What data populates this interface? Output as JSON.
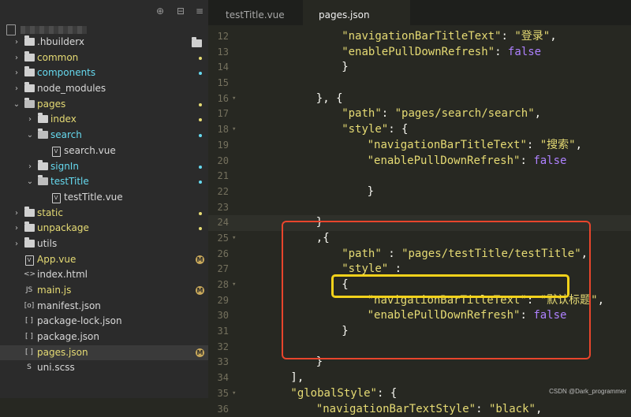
{
  "sidebar": {
    "toolbar_icons": [
      "target-icon",
      "collapse-icon",
      "menu-icon"
    ],
    "tree": [
      {
        "label": ".hbuilderx",
        "type": "folder",
        "depth": 0,
        "state": "closed",
        "color": "white",
        "badge": "folder"
      },
      {
        "label": "common",
        "type": "folder",
        "depth": 0,
        "state": "closed",
        "color": "yellow",
        "badge": "dot-yellow"
      },
      {
        "label": "components",
        "type": "folder",
        "depth": 0,
        "state": "closed",
        "color": "blue",
        "badge": "dot-blue"
      },
      {
        "label": "node_modules",
        "type": "folder",
        "depth": 0,
        "state": "closed",
        "color": "white",
        "badge": ""
      },
      {
        "label": "pages",
        "type": "folder",
        "depth": 0,
        "state": "open",
        "color": "yellow",
        "badge": "dot-yellow"
      },
      {
        "label": "index",
        "type": "folder",
        "depth": 1,
        "state": "closed",
        "color": "yellow",
        "badge": "dot-yellow"
      },
      {
        "label": "search",
        "type": "folder",
        "depth": 1,
        "state": "open",
        "color": "blue",
        "badge": "dot-blue"
      },
      {
        "label": "search.vue",
        "type": "file",
        "depth": 2,
        "icon": "V",
        "color": "white",
        "badge": ""
      },
      {
        "label": "signIn",
        "type": "folder",
        "depth": 1,
        "state": "closed",
        "color": "blue",
        "badge": "dot-blue"
      },
      {
        "label": "testTitle",
        "type": "folder",
        "depth": 1,
        "state": "open",
        "color": "blue",
        "badge": "dot-blue"
      },
      {
        "label": "testTitle.vue",
        "type": "file",
        "depth": 2,
        "icon": "V",
        "color": "white",
        "badge": ""
      },
      {
        "label": "static",
        "type": "folder",
        "depth": 0,
        "state": "closed",
        "color": "yellow",
        "badge": "dot-yellow"
      },
      {
        "label": "unpackage",
        "type": "folder",
        "depth": 0,
        "state": "closed",
        "color": "yellow",
        "badge": "dot-yellow"
      },
      {
        "label": "utils",
        "type": "folder",
        "depth": 0,
        "state": "closed",
        "color": "white",
        "badge": ""
      },
      {
        "label": "App.vue",
        "type": "file",
        "depth": 0,
        "icon": "V",
        "color": "yellow",
        "badge": "M"
      },
      {
        "label": "index.html",
        "type": "file",
        "depth": 0,
        "icon": "<>",
        "color": "white",
        "badge": ""
      },
      {
        "label": "main.js",
        "type": "file",
        "depth": 0,
        "icon": "JS",
        "color": "yellow",
        "badge": "M"
      },
      {
        "label": "manifest.json",
        "type": "file",
        "depth": 0,
        "icon": "[o]",
        "color": "white",
        "badge": ""
      },
      {
        "label": "package-lock.json",
        "type": "file",
        "depth": 0,
        "icon": "[ ]",
        "color": "white",
        "badge": ""
      },
      {
        "label": "package.json",
        "type": "file",
        "depth": 0,
        "icon": "[ ]",
        "color": "white",
        "badge": ""
      },
      {
        "label": "pages.json",
        "type": "file",
        "depth": 0,
        "icon": "[ ]",
        "color": "yellow",
        "badge": "M",
        "selected": true
      },
      {
        "label": "uni.scss",
        "type": "file",
        "depth": 0,
        "icon": "S",
        "color": "white",
        "badge": ""
      }
    ]
  },
  "tabs": [
    {
      "label": "testTitle.vue",
      "active": false
    },
    {
      "label": "pages.json",
      "active": true
    }
  ],
  "code_lines": [
    {
      "n": "12",
      "fold": "",
      "indent": 12,
      "tokens": [
        [
          "s",
          "\"navigationBarTitleText\""
        ],
        [
          "p",
          ": "
        ],
        [
          "s",
          "\"登录\""
        ],
        [
          "p",
          ","
        ]
      ]
    },
    {
      "n": "13",
      "fold": "",
      "indent": 12,
      "tokens": [
        [
          "s",
          "\"enablePullDownRefresh\""
        ],
        [
          "p",
          ": "
        ],
        [
          "b",
          "false"
        ]
      ]
    },
    {
      "n": "14",
      "fold": "",
      "indent": 12,
      "tokens": [
        [
          "p",
          "}"
        ]
      ]
    },
    {
      "n": "15",
      "fold": "",
      "indent": 0,
      "tokens": []
    },
    {
      "n": "16",
      "fold": "▾",
      "indent": 8,
      "tokens": [
        [
          "p",
          "}, {"
        ]
      ]
    },
    {
      "n": "17",
      "fold": "",
      "indent": 12,
      "tokens": [
        [
          "s",
          "\"path\""
        ],
        [
          "p",
          ": "
        ],
        [
          "s",
          "\"pages/search/search\""
        ],
        [
          "p",
          ","
        ]
      ]
    },
    {
      "n": "18",
      "fold": "▾",
      "indent": 12,
      "tokens": [
        [
          "s",
          "\"style\""
        ],
        [
          "p",
          ": {"
        ]
      ]
    },
    {
      "n": "19",
      "fold": "",
      "indent": 16,
      "tokens": [
        [
          "s",
          "\"navigationBarTitleText\""
        ],
        [
          "p",
          ": "
        ],
        [
          "s",
          "\"搜索\""
        ],
        [
          "p",
          ","
        ]
      ]
    },
    {
      "n": "20",
      "fold": "",
      "indent": 16,
      "tokens": [
        [
          "s",
          "\"enablePullDownRefresh\""
        ],
        [
          "p",
          ": "
        ],
        [
          "b",
          "false"
        ]
      ]
    },
    {
      "n": "21",
      "fold": "",
      "indent": 0,
      "tokens": []
    },
    {
      "n": "22",
      "fold": "",
      "indent": 16,
      "tokens": [
        [
          "p",
          "}"
        ]
      ]
    },
    {
      "n": "23",
      "fold": "",
      "indent": 0,
      "tokens": []
    },
    {
      "n": "24",
      "fold": "",
      "indent": 8,
      "tokens": [
        [
          "p",
          "}"
        ]
      ],
      "highlight": true
    },
    {
      "n": "25",
      "fold": "▾",
      "indent": 8,
      "tokens": [
        [
          "p",
          ",{"
        ]
      ]
    },
    {
      "n": "26",
      "fold": "",
      "indent": 12,
      "tokens": [
        [
          "s",
          "\"path\""
        ],
        [
          "p",
          " : "
        ],
        [
          "s",
          "\"pages/testTitle/testTitle\""
        ],
        [
          "p",
          ","
        ]
      ]
    },
    {
      "n": "27",
      "fold": "",
      "indent": 12,
      "tokens": [
        [
          "s",
          "\"style\""
        ],
        [
          "p",
          " :"
        ]
      ]
    },
    {
      "n": "28",
      "fold": "▾",
      "indent": 12,
      "tokens": [
        [
          "p",
          "{"
        ]
      ]
    },
    {
      "n": "29",
      "fold": "",
      "indent": 16,
      "tokens": [
        [
          "s",
          "\"navigationBarTitleText\""
        ],
        [
          "p",
          ": "
        ],
        [
          "s",
          "\"默认标题\""
        ],
        [
          "p",
          ","
        ]
      ]
    },
    {
      "n": "30",
      "fold": "",
      "indent": 16,
      "tokens": [
        [
          "s",
          "\"enablePullDownRefresh\""
        ],
        [
          "p",
          ": "
        ],
        [
          "b",
          "false"
        ]
      ]
    },
    {
      "n": "31",
      "fold": "",
      "indent": 12,
      "tokens": [
        [
          "p",
          "}"
        ]
      ]
    },
    {
      "n": "32",
      "fold": "",
      "indent": 0,
      "tokens": []
    },
    {
      "n": "33",
      "fold": "",
      "indent": 8,
      "tokens": [
        [
          "p",
          "}"
        ]
      ]
    },
    {
      "n": "34",
      "fold": "",
      "indent": 4,
      "tokens": [
        [
          "p",
          "],"
        ]
      ]
    },
    {
      "n": "35",
      "fold": "▾",
      "indent": 4,
      "tokens": [
        [
          "s",
          "\"globalStyle\""
        ],
        [
          "p",
          ": {"
        ]
      ]
    },
    {
      "n": "36",
      "fold": "",
      "indent": 8,
      "tokens": [
        [
          "s",
          "\"navigationBarTextStyle\""
        ],
        [
          "p",
          ": "
        ],
        [
          "s",
          "\"black\""
        ],
        [
          "p",
          ","
        ]
      ]
    }
  ],
  "watermark": "CSDN @Dark_programmer",
  "colors": {
    "string": "#e6db74",
    "boolean": "#ae81ff",
    "annotation_red": "#e8452c",
    "annotation_yellow": "#f2d21b"
  }
}
